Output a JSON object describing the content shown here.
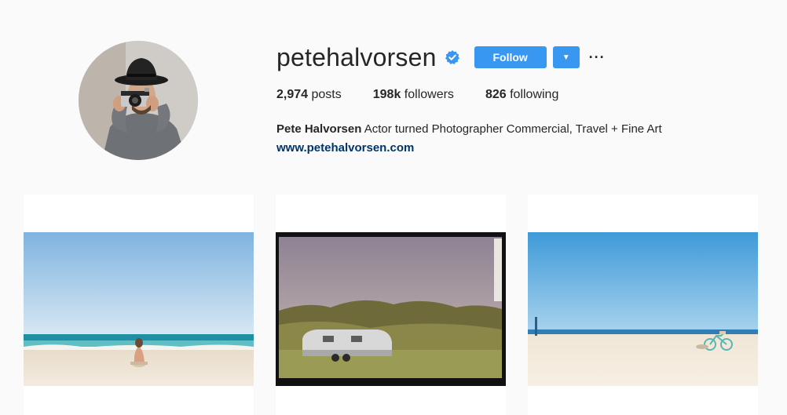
{
  "profile": {
    "username": "petehalvorsen",
    "follow_label": "Follow",
    "dropdown_symbol": "▼",
    "more_symbol": "···",
    "stats": {
      "posts_count": "2,974",
      "posts_label": "posts",
      "followers_count": "198k",
      "followers_label": "followers",
      "following_count": "826",
      "following_label": "following"
    },
    "full_name": "Pete Halvorsen",
    "bio_text": " Actor turned Photographer Commercial, Travel + Fine Art",
    "website": "www.petehalvorsen.com"
  },
  "colors": {
    "accent": "#3897f0",
    "link": "#003569",
    "background": "#fafafa"
  },
  "icons": {
    "verified": "verified-badge-icon",
    "dropdown": "chevron-down-icon",
    "more": "more-options-icon"
  }
}
